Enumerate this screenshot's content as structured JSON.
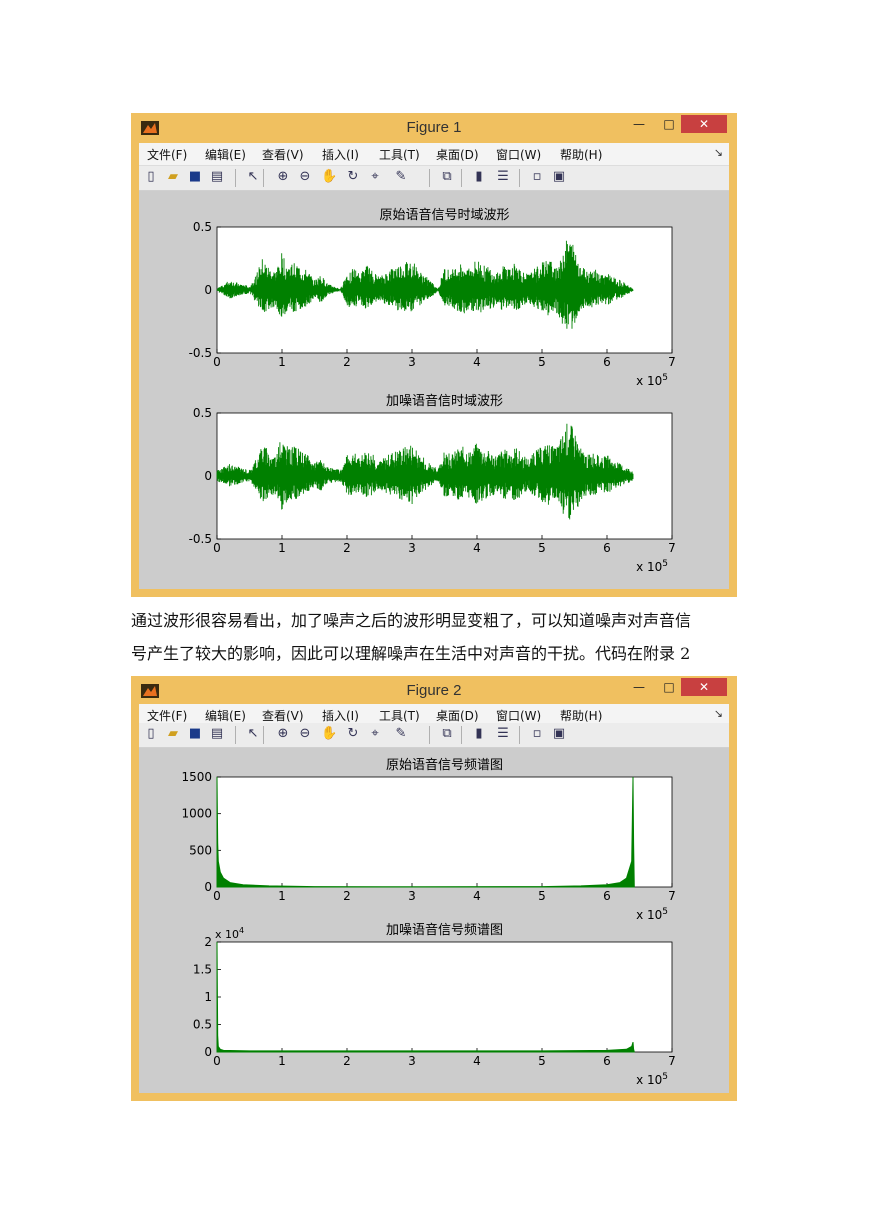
{
  "figures": [
    {
      "title": "Figure 1",
      "menus": [
        "文件(F)",
        "编辑(E)",
        "查看(V)",
        "插入(I)",
        "工具(T)",
        "桌面(D)",
        "窗口(W)",
        "帮助(H)"
      ],
      "window_buttons": {
        "minimize": "—",
        "maximize": "□",
        "close": "✕"
      },
      "toolbar_icons": [
        "new-file-icon",
        "open-folder-icon",
        "save-icon",
        "print-icon",
        "pointer-icon",
        "zoom-in-icon",
        "zoom-out-icon",
        "pan-hand-icon",
        "rotate-3d-icon",
        "data-cursor-icon",
        "brush-icon",
        "link-plot-icon",
        "colorbar-icon",
        "legend-icon",
        "hide-plot-tools-icon",
        "show-plot-tools-icon"
      ]
    },
    {
      "title": "Figure 2",
      "menus": [
        "文件(F)",
        "编辑(E)",
        "查看(V)",
        "插入(I)",
        "工具(T)",
        "桌面(D)",
        "窗口(W)",
        "帮助(H)"
      ],
      "window_buttons": {
        "minimize": "—",
        "maximize": "□",
        "close": "✕"
      },
      "toolbar_icons": [
        "new-file-icon",
        "open-folder-icon",
        "save-icon",
        "print-icon",
        "pointer-icon",
        "zoom-in-icon",
        "zoom-out-icon",
        "pan-hand-icon",
        "rotate-3d-icon",
        "data-cursor-icon",
        "brush-icon",
        "link-plot-icon",
        "colorbar-icon",
        "legend-icon",
        "hide-plot-tools-icon",
        "show-plot-tools-icon"
      ]
    }
  ],
  "paragraph": {
    "line1": "通过波形很容易看出，加了噪声之后的波形明显变粗了，可以知道噪声对声音信",
    "line2": "号产生了较大的影响，因此可以理解噪声在生活中对声音的干扰。代码在附录 2"
  },
  "colors": {
    "series": "#008000",
    "frame": "#f0c060",
    "canvas": "#cccccc"
  },
  "chart_data": [
    {
      "type": "line",
      "title": "原始语音信号时域波形",
      "xlim": [
        0,
        7
      ],
      "x_exponent": "x 10^5",
      "xticks": [
        "0",
        "1",
        "2",
        "3",
        "4",
        "5",
        "6",
        "7"
      ],
      "ylim": [
        -0.5,
        0.5
      ],
      "yticks": [
        "-0.5",
        "0",
        "0.5"
      ],
      "series": [
        {
          "envelope_x": [
            0,
            0.1,
            0.2,
            0.3,
            0.5,
            0.6,
            0.7,
            0.8,
            0.9,
            1.0,
            1.1,
            1.2,
            1.3,
            1.4,
            1.5,
            1.6,
            1.7,
            1.9,
            2.0,
            2.1,
            2.2,
            2.3,
            2.4,
            2.5,
            2.7,
            2.8,
            2.9,
            3.0,
            3.1,
            3.2,
            3.4,
            3.5,
            3.6,
            3.7,
            3.8,
            3.9,
            4.0,
            4.1,
            4.2,
            4.3,
            4.4,
            4.5,
            4.6,
            4.7,
            4.8,
            4.9,
            5.0,
            5.1,
            5.2,
            5.3,
            5.4,
            5.5,
            5.6,
            5.7,
            5.8,
            5.9,
            6.0,
            6.1,
            6.2,
            6.3,
            6.4
          ],
          "envelope_y": [
            0.01,
            0.05,
            0.08,
            0.06,
            0.03,
            0.12,
            0.25,
            0.18,
            0.15,
            0.3,
            0.2,
            0.22,
            0.18,
            0.15,
            0.08,
            0.12,
            0.05,
            0.01,
            0.15,
            0.18,
            0.12,
            0.2,
            0.15,
            0.1,
            0.18,
            0.2,
            0.22,
            0.25,
            0.15,
            0.12,
            0.01,
            0.18,
            0.15,
            0.2,
            0.22,
            0.18,
            0.25,
            0.2,
            0.18,
            0.15,
            0.2,
            0.18,
            0.22,
            0.15,
            0.12,
            0.18,
            0.22,
            0.25,
            0.2,
            0.3,
            0.42,
            0.35,
            0.2,
            0.15,
            0.18,
            0.12,
            0.15,
            0.1,
            0.08,
            0.05,
            0.01
          ]
        }
      ]
    },
    {
      "type": "line",
      "title": "加噪语音信时域波形",
      "xlim": [
        0,
        7
      ],
      "x_exponent": "x 10^5",
      "xticks": [
        "0",
        "1",
        "2",
        "3",
        "4",
        "5",
        "6",
        "7"
      ],
      "ylim": [
        -0.5,
        0.5
      ],
      "yticks": [
        "-0.5",
        "0",
        "0.5"
      ],
      "noise_floor": 0.04,
      "series": [
        {
          "envelope_x": [
            0,
            0.1,
            0.2,
            0.3,
            0.5,
            0.6,
            0.7,
            0.8,
            0.9,
            1.0,
            1.1,
            1.2,
            1.3,
            1.4,
            1.5,
            1.6,
            1.7,
            1.9,
            2.0,
            2.1,
            2.2,
            2.3,
            2.4,
            2.5,
            2.7,
            2.8,
            2.9,
            3.0,
            3.1,
            3.2,
            3.4,
            3.5,
            3.6,
            3.7,
            3.8,
            3.9,
            4.0,
            4.1,
            4.2,
            4.3,
            4.4,
            4.5,
            4.6,
            4.7,
            4.8,
            4.9,
            5.0,
            5.1,
            5.2,
            5.3,
            5.4,
            5.5,
            5.6,
            5.7,
            5.8,
            5.9,
            6.0,
            6.1,
            6.2,
            6.3,
            6.4
          ],
          "envelope_y": [
            0.05,
            0.07,
            0.1,
            0.08,
            0.05,
            0.14,
            0.27,
            0.2,
            0.17,
            0.32,
            0.22,
            0.24,
            0.2,
            0.17,
            0.1,
            0.14,
            0.07,
            0.05,
            0.17,
            0.2,
            0.14,
            0.22,
            0.17,
            0.12,
            0.2,
            0.22,
            0.24,
            0.27,
            0.17,
            0.14,
            0.05,
            0.2,
            0.17,
            0.22,
            0.24,
            0.2,
            0.27,
            0.22,
            0.2,
            0.17,
            0.22,
            0.2,
            0.24,
            0.17,
            0.14,
            0.2,
            0.24,
            0.27,
            0.22,
            0.32,
            0.45,
            0.37,
            0.22,
            0.17,
            0.2,
            0.14,
            0.17,
            0.12,
            0.1,
            0.07,
            0.05
          ]
        }
      ]
    },
    {
      "type": "line",
      "title": "原始语音信号频谱图",
      "xlim": [
        0,
        7
      ],
      "x_exponent": "x 10^5",
      "xticks": [
        "0",
        "1",
        "2",
        "3",
        "4",
        "5",
        "6",
        "7"
      ],
      "ylim": [
        0,
        1500
      ],
      "yticks": [
        "0",
        "500",
        "1000",
        "1500"
      ],
      "series": [
        {
          "x": [
            0,
            0.01,
            0.02,
            0.05,
            0.1,
            0.2,
            0.4,
            0.8,
            1.5,
            3.2,
            5.0,
            5.6,
            6.0,
            6.2,
            6.3,
            6.38,
            6.4,
            6.41,
            6.42
          ],
          "y": [
            1500,
            600,
            350,
            200,
            120,
            60,
            30,
            15,
            6,
            3,
            6,
            15,
            30,
            60,
            120,
            350,
            1500,
            600,
            0
          ]
        }
      ]
    },
    {
      "type": "line",
      "title": "加噪语音信号频谱图",
      "xlim": [
        0,
        7
      ],
      "x_exponent": "x 10^5",
      "xticks": [
        "0",
        "1",
        "2",
        "3",
        "4",
        "5",
        "6",
        "7"
      ],
      "ylim": [
        0,
        2
      ],
      "y_exponent": "x 10^4",
      "yticks": [
        "0",
        "0.5",
        "1",
        "1.5",
        "2"
      ],
      "series": [
        {
          "x": [
            0,
            0.01,
            0.02,
            0.05,
            0.1,
            0.5,
            1.0,
            3.0,
            5.0,
            6.0,
            6.3,
            6.38,
            6.4,
            6.41,
            6.42
          ],
          "y": [
            2.0,
            0.3,
            0.1,
            0.05,
            0.03,
            0.02,
            0.02,
            0.02,
            0.02,
            0.03,
            0.05,
            0.1,
            0.18,
            0.05,
            0
          ]
        }
      ]
    }
  ]
}
